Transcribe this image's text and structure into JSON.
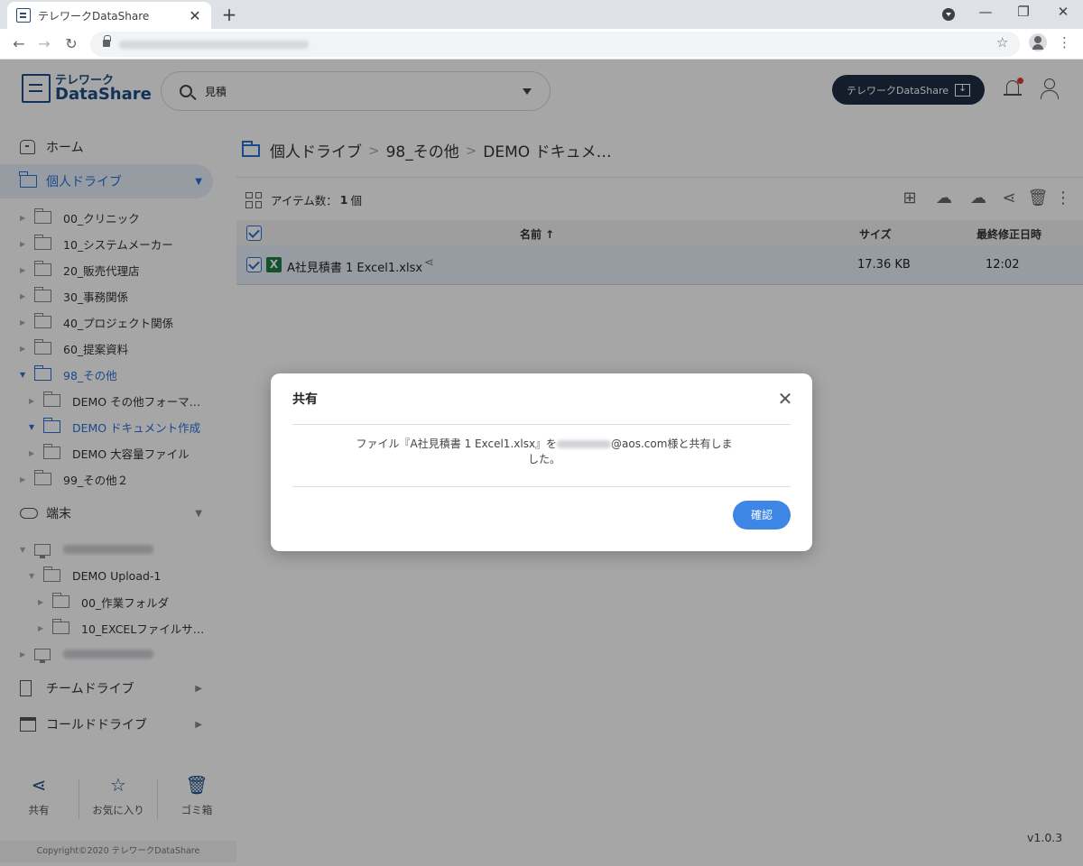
{
  "browser": {
    "tab_title": "テレワークDataShare",
    "tab_close": "✕",
    "new_tab": "+",
    "minimize": "—",
    "restore": "❐",
    "close": "✕"
  },
  "app": {
    "logo_line1": "テレワーク",
    "logo_line2": "DataShare",
    "search_value": "見積",
    "download_button": "テレワークDataShare"
  },
  "sidebar": {
    "home": "ホーム",
    "personal_drive": "個人ドライブ",
    "folders": [
      "00_クリニック",
      "10_システムメーカー",
      "20_販売代理店",
      "30_事務関係",
      "40_プロジェクト関係",
      "60_提案資料",
      "98_その他"
    ],
    "subfolders": [
      "DEMO その他フォーマ…",
      "DEMO ドキュメント作成",
      "DEMO 大容量ファイル"
    ],
    "folder_last": "99_その他２",
    "device": "端末",
    "device_folder": "DEMO Upload-1",
    "device_subfolders": [
      "00_作業フォルダ",
      "10_EXCELファイルサ…"
    ],
    "team_drive": "チームドライブ",
    "cold_drive": "コールドドライブ",
    "bottom_actions": {
      "share": "共有",
      "favorites": "お気に入り",
      "trash": "ゴミ箱"
    },
    "copyright": "Copyright©2020 テレワークDataShare"
  },
  "main": {
    "breadcrumb": [
      "個人ドライブ",
      "98_その他",
      "DEMO ドキュメ…"
    ],
    "item_count_label": "アイテム数：",
    "item_count_value": "1",
    "item_count_unit": "個",
    "table": {
      "col_name": "名前 ↑",
      "col_size": "サイズ",
      "col_modified": "最終修正日時",
      "rows": [
        {
          "name": "A社見積書 1 Excel1.xlsx",
          "size": "17.36 KB",
          "modified": "12:02"
        }
      ]
    },
    "version": "v1.0.3"
  },
  "dialog": {
    "title": "共有",
    "close": "✕",
    "message_prefix": "ファイル『A社見積書 1 Excel1.xlsx』を",
    "message_suffix": "@aos.com様と共有しま",
    "message_line2": "した。",
    "ok_button": "確認"
  }
}
